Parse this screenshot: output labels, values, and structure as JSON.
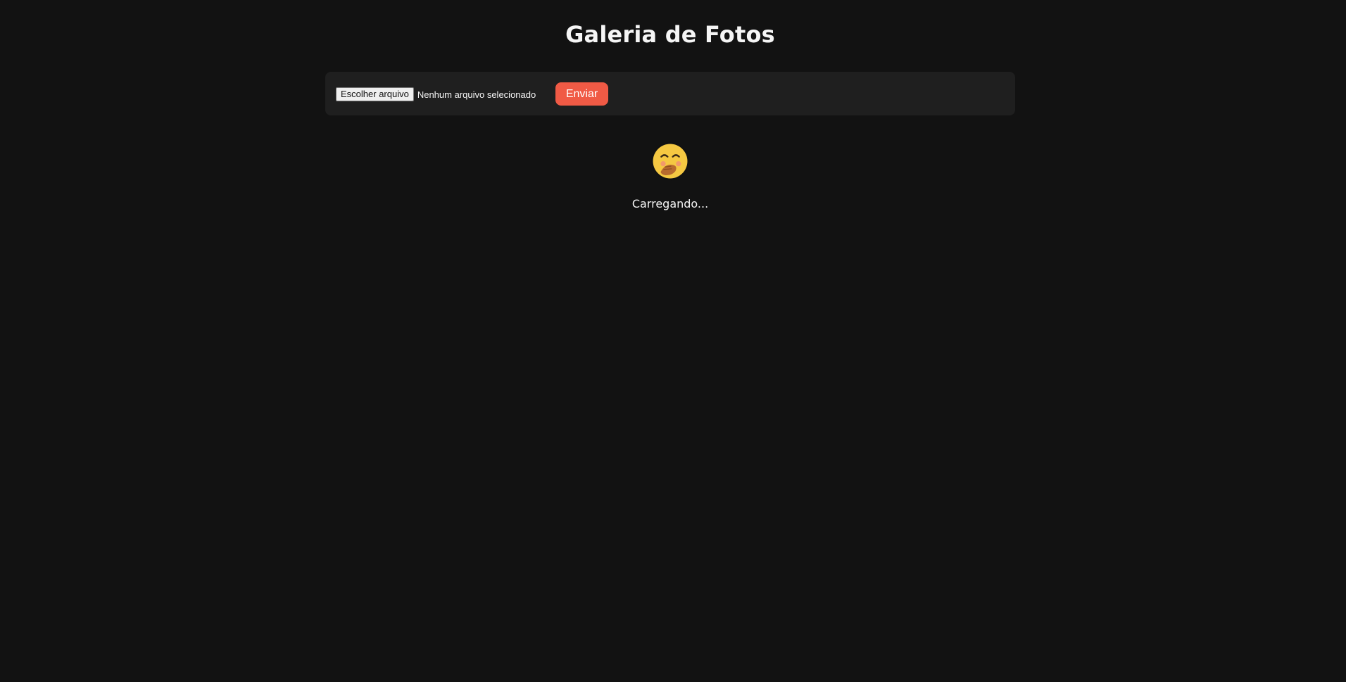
{
  "page": {
    "title": "Galeria de Fotos"
  },
  "upload": {
    "file_button_label": "Escolher arquivo",
    "file_status": "Nenhum arquivo selecionado",
    "submit_label": "Enviar"
  },
  "loading": {
    "icon": "hand-over-mouth-emoji",
    "text": "Carregando..."
  },
  "colors": {
    "background": "#121212",
    "panel": "#1f1f1f",
    "accent": "#f05a45",
    "text": "#f5f5f5"
  }
}
